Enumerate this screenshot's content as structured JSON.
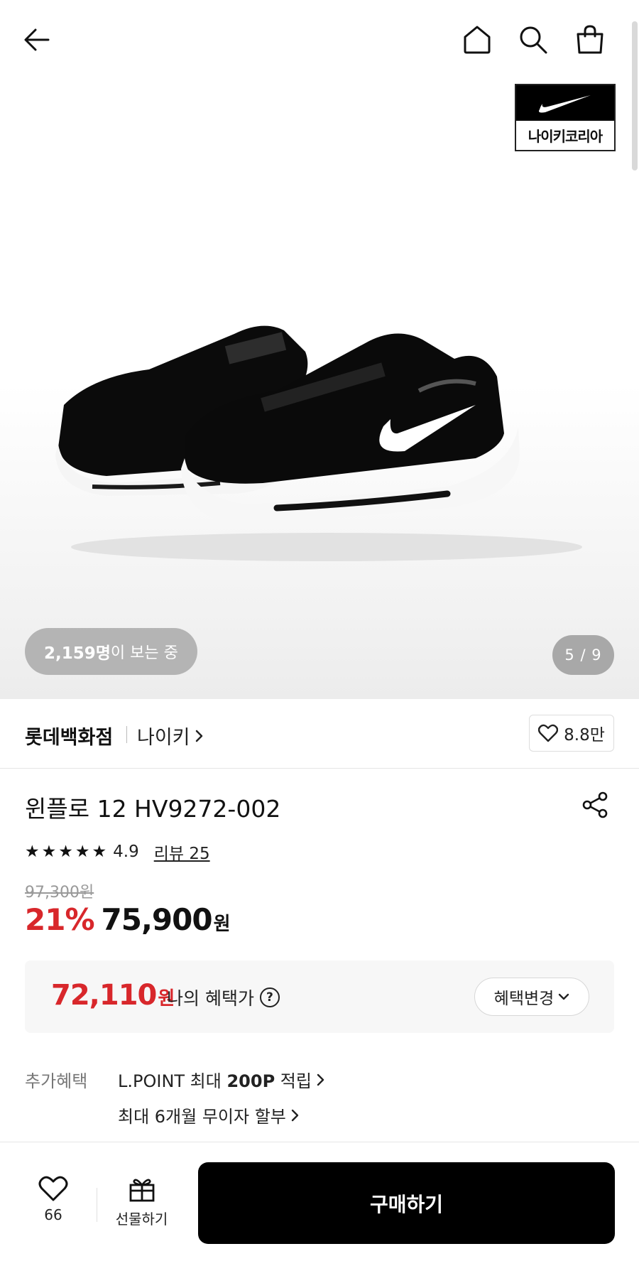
{
  "header": {
    "icons": [
      "back-arrow-icon",
      "home-icon",
      "search-icon",
      "shopping-bag-icon"
    ]
  },
  "brand_logo": {
    "text": "나이키코리아",
    "icon": "nike-swoosh-icon"
  },
  "hero": {
    "viewers_count": "2,159명",
    "viewers_suffix": "이 보는 중",
    "page_indicator": "5 / 9"
  },
  "store": {
    "name": "롯데백화점",
    "brand_link": "나이키",
    "like_count": "8.8만"
  },
  "product": {
    "title": "윈플로 12 HV9272-002",
    "rating": "4.9",
    "stars": 5,
    "review_link": "리뷰 25",
    "original_price": "97,300원",
    "discount": "21%",
    "sale_price": "75,900",
    "sale_unit": "원"
  },
  "benefit": {
    "price": "72,110",
    "unit": "원",
    "label": "나의 혜택가",
    "change_button": "혜택변경"
  },
  "extra": {
    "label": "추가혜택",
    "item1_prefix": "L.POINT 최대 ",
    "item1_bold": "200P",
    "item1_suffix": " 적립",
    "item2": "최대 6개월 무이자 할부"
  },
  "bottom_bar": {
    "wish_count": "66",
    "gift_label": "선물하기",
    "buy_label": "구매하기"
  },
  "colors": {
    "accent_red": "#d8272b",
    "primary_black": "#000000"
  }
}
